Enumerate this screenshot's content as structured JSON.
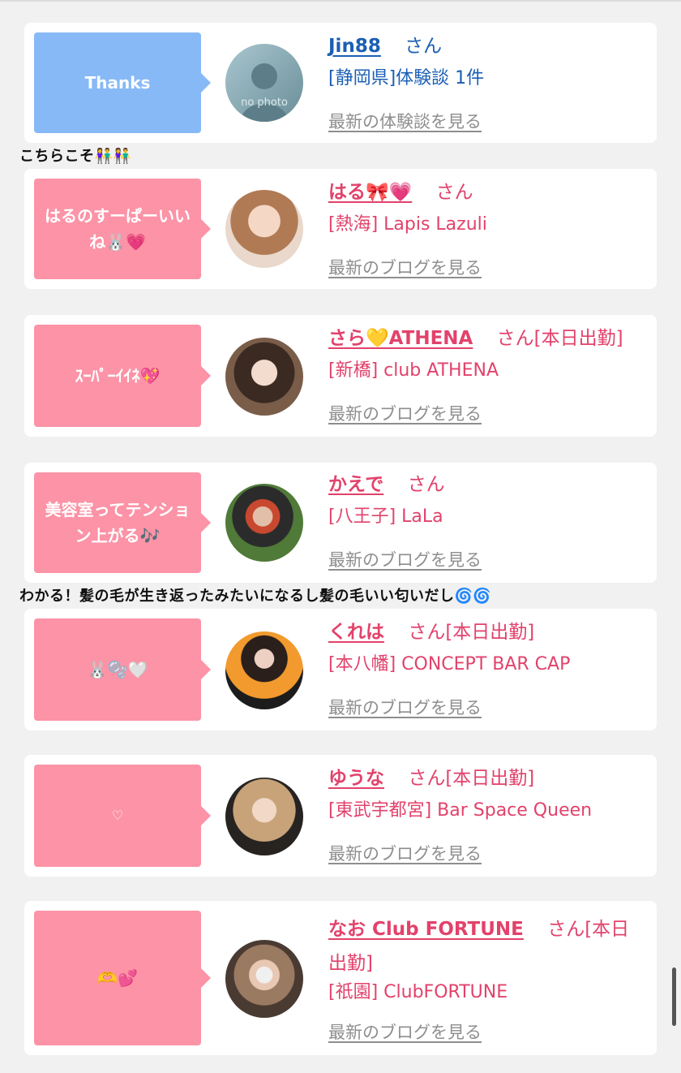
{
  "cards": [
    {
      "bubble": "Thanks",
      "bubble_color": "blue",
      "name": "Jin88",
      "honorific": "さん",
      "shop": "[静岡県]体験談 1件",
      "link": "最新の体験談を見る",
      "avatar": "no-photo",
      "avatar_label": "no photo"
    },
    {
      "bubble": "はるのすーぱーいいね🐰💗",
      "bubble_color": "pink",
      "name": "はる🎀💗",
      "honorific": "さん",
      "status": "",
      "shop": "[熱海] Lapis Lazuli",
      "link": "最新のブログを見る"
    },
    {
      "bubble": "ｽｰﾊﾟｰｲｲﾈ💖",
      "bubble_color": "pink",
      "name": "さら💛ATHENA",
      "honorific": "さん",
      "status": "[本日出勤]",
      "shop": "[新橋] club ATHENA",
      "link": "最新のブログを見る"
    },
    {
      "bubble": "美容室ってテンション上がる🎶",
      "bubble_color": "pink",
      "name": "かえで",
      "honorific": "さん",
      "status": "",
      "shop": "[八王子] LaLa",
      "link": "最新のブログを見る"
    },
    {
      "bubble": "🐰🫧🤍",
      "bubble_color": "pink",
      "name": "くれは",
      "honorific": "さん",
      "status": "[本日出勤]",
      "shop": "[本八幡] CONCEPT BAR CAP",
      "link": "最新のブログを見る"
    },
    {
      "bubble": "♡",
      "bubble_color": "pink",
      "name": "ゆうな",
      "honorific": "さん",
      "status": "[本日出勤]",
      "shop": "[東武宇都宮] Bar Space Queen",
      "link": "最新のブログを見る"
    },
    {
      "bubble": "🫶💕",
      "bubble_color": "pink",
      "name": "なお Club FORTUNE",
      "honorific": "さん",
      "status": "[本日出勤]",
      "shop": "[祇園] ClubFORTUNE",
      "link": "最新のブログを見る"
    }
  ],
  "comments": [
    "こちらこそ👫👫",
    "わかる！髪の毛が生き返ったみたいになるし髪の毛いい匂いだし🌀🌀"
  ],
  "colors": {
    "pink_bubble": "#fc93a6",
    "blue_bubble": "#88b9f7",
    "pink_text": "#e2426b",
    "blue_text": "#1b5fb4"
  }
}
